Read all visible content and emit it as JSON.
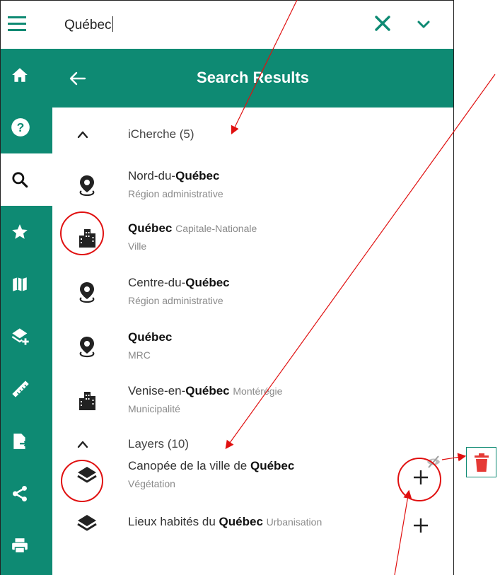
{
  "search": {
    "value": "Québec"
  },
  "header": {
    "title": "Search Results"
  },
  "rail": {
    "items": [
      {
        "name": "home-icon"
      },
      {
        "name": "help-icon"
      },
      {
        "name": "search-icon"
      },
      {
        "name": "star-icon"
      },
      {
        "name": "map-icon"
      },
      {
        "name": "add-layer-icon"
      },
      {
        "name": "ruler-icon"
      },
      {
        "name": "export-file-icon"
      },
      {
        "name": "share-icon"
      },
      {
        "name": "print-icon"
      }
    ]
  },
  "groups": [
    {
      "label": "iCherche (5)",
      "results": [
        {
          "pre": "Nord-du-",
          "bold": "Québec",
          "post": "",
          "region": "",
          "sub": "Région administrative",
          "icon": "map-pin-icon"
        },
        {
          "pre": "",
          "bold": "Québec",
          "post": "",
          "region": "Capitale-Nationale",
          "sub": "Ville",
          "icon": "city-buildings-icon"
        },
        {
          "pre": "Centre-du-",
          "bold": "Québec",
          "post": "",
          "region": "",
          "sub": "Région administrative",
          "icon": "map-pin-icon"
        },
        {
          "pre": "",
          "bold": "Québec",
          "post": "",
          "region": "",
          "sub": "MRC",
          "icon": "map-pin-icon"
        },
        {
          "pre": "Venise-en-",
          "bold": "Québec",
          "post": "",
          "region": "Montérégie",
          "sub": "Municipalité",
          "icon": "city-buildings-icon"
        }
      ]
    },
    {
      "label": "Layers (10)",
      "results": [
        {
          "pre": "Canopée de la ville de ",
          "bold": "Québec",
          "post": "",
          "region": "",
          "sub": "Végétation",
          "icon": "layers-icon"
        },
        {
          "pre": "Lieux habités du ",
          "bold": "Québec",
          "post": "",
          "region": "Urbanisation",
          "sub": "",
          "icon": "layers-icon"
        }
      ]
    }
  ],
  "colors": {
    "accent": "#0e8a73",
    "annotation": "#e01010",
    "delete": "#e53935"
  }
}
